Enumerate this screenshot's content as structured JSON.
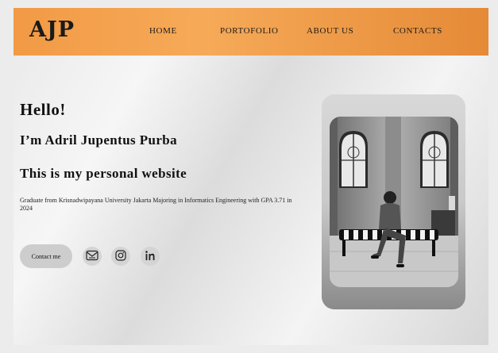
{
  "nav": {
    "logo": "AJP",
    "links": [
      "HOME",
      "PORTOFOLIO",
      "ABOUT US",
      "CONTACTS"
    ]
  },
  "hero": {
    "greeting": "Hello!",
    "name_line": "I’m Adril Jupentus Purba",
    "tagline": "This is my personal website",
    "description": "Graduate from Krisnadwipayana University Jakarta Majoring in Informatics Engineering with GPA 3.71 in 2024",
    "contact_button": "Contact me"
  },
  "social_icons": [
    "mail-icon",
    "instagram-icon",
    "linkedin-icon"
  ],
  "colors": {
    "nav_start": "#f29a45",
    "nav_end": "#e58a37",
    "button_bg": "#cdcdcd"
  }
}
